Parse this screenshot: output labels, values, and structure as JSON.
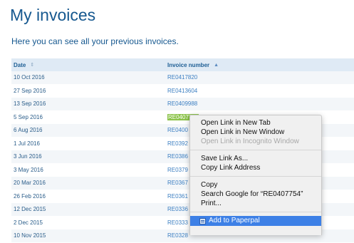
{
  "page": {
    "title": "My invoices",
    "intro": "Here you can see all your previous invoices."
  },
  "table": {
    "columns": {
      "date": "Date",
      "invoice_number": "Invoice number"
    },
    "sort_icons": {
      "date": "⇕",
      "invoice_number": "▲"
    },
    "rows": [
      {
        "date": "10 Oct 2016",
        "invoice": "RE0417820"
      },
      {
        "date": "27 Sep 2016",
        "invoice": "RE0413604"
      },
      {
        "date": "13 Sep 2016",
        "invoice": "RE0409988"
      },
      {
        "date": "5 Sep 2016",
        "invoice": "RE0407754"
      },
      {
        "date": "6 Aug 2016",
        "invoice": "RE0400"
      },
      {
        "date": "1 Jul 2016",
        "invoice": "RE0392"
      },
      {
        "date": "3 Jun 2016",
        "invoice": "RE0386"
      },
      {
        "date": "3 May 2016",
        "invoice": "RE0379"
      },
      {
        "date": "20 Mar 2016",
        "invoice": "RE0367"
      },
      {
        "date": "26 Feb 2016",
        "invoice": "RE0361"
      },
      {
        "date": "12 Dec 2015",
        "invoice": "RE0336"
      },
      {
        "date": "2 Dec 2015",
        "invoice": "RE0333"
      },
      {
        "date": "10 Nov 2015",
        "invoice": "RE0328"
      }
    ]
  },
  "context_menu": {
    "open_new_tab": "Open Link in New Tab",
    "open_new_window": "Open Link in New Window",
    "open_incognito": "Open Link in Incognito Window",
    "save_link": "Save Link As...",
    "copy_link": "Copy Link Address",
    "copy": "Copy",
    "search_google": "Search Google for “RE0407754”",
    "print": "Print...",
    "add_paperpal": "Add to Paperpal"
  }
}
